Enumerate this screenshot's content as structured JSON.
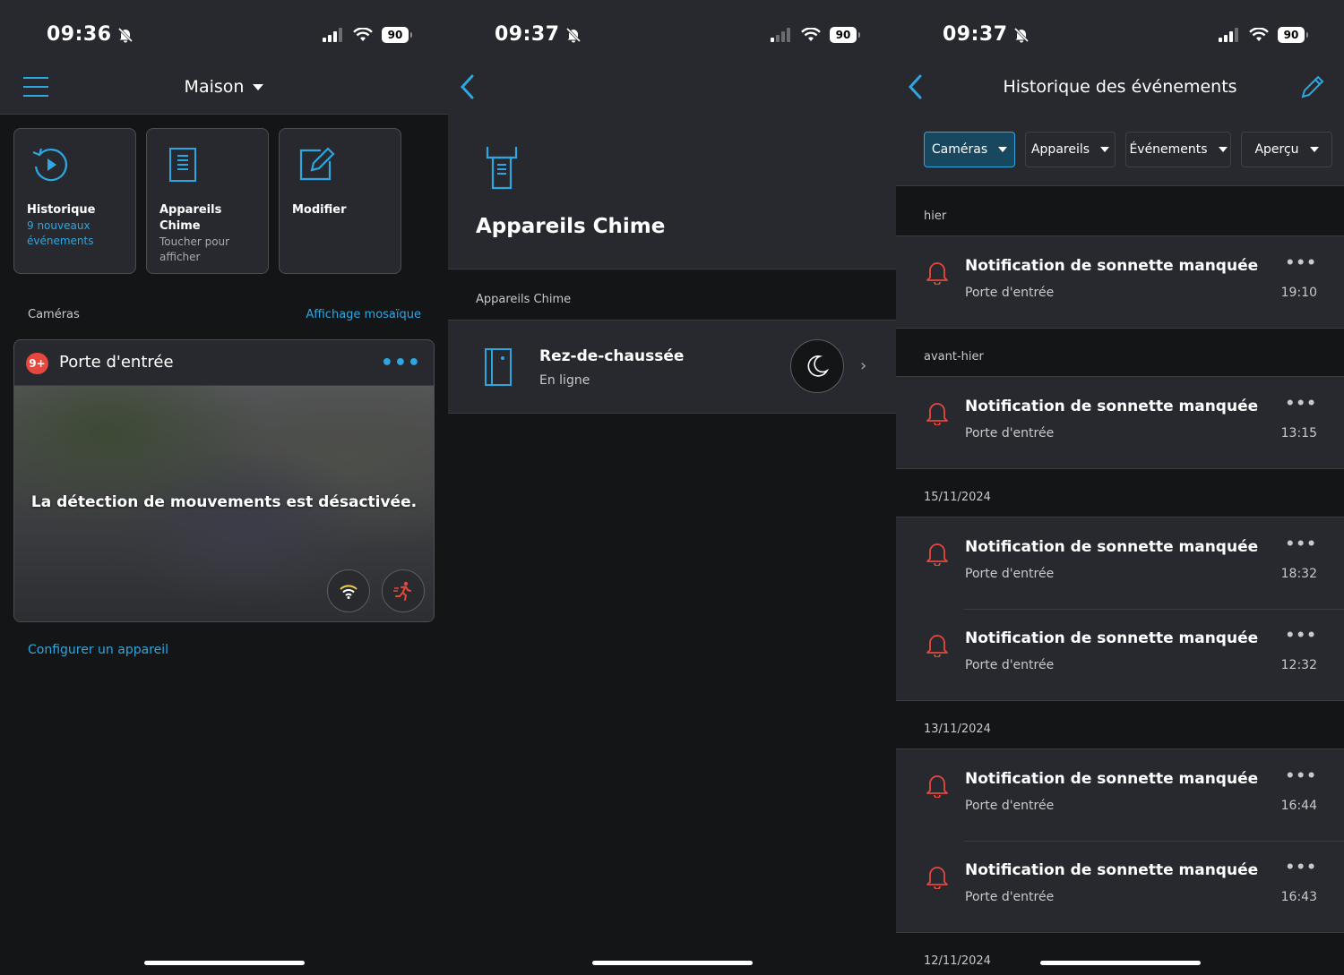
{
  "status": {
    "p1_time": "09:36",
    "p2_time": "09:37",
    "p3_time": "09:37",
    "battery": "90"
  },
  "home": {
    "title": "Maison",
    "tiles": [
      {
        "label": "Historique",
        "sub": "9 nouveaux événements"
      },
      {
        "label": "Appareils Chime",
        "sub": "Toucher pour afficher"
      },
      {
        "label": "Modifier",
        "sub": ""
      }
    ],
    "cameras_label": "Caméras",
    "mosaic_link": "Affichage mosaïque",
    "camera": {
      "badge": "9+",
      "name": "Porte d'entrée",
      "more": "•••",
      "message": "La détection de mouvements est désactivée."
    },
    "configure_link": "Configurer un appareil"
  },
  "chime": {
    "title": "Appareils Chime",
    "section": "Appareils Chime",
    "device": {
      "name": "Rez-de-chaussée",
      "status": "En ligne",
      "chevron": "›"
    }
  },
  "history": {
    "title": "Historique des événements",
    "filters": [
      "Caméras",
      "Appareils",
      "Événements",
      "Aperçu"
    ],
    "groups": [
      {
        "date": "hier",
        "events": [
          {
            "title": "Notification de sonnette manquée",
            "source": "Porte d'entrée",
            "time": "19:10"
          }
        ]
      },
      {
        "date": "avant-hier",
        "events": [
          {
            "title": "Notification de sonnette manquée",
            "source": "Porte d'entrée",
            "time": "13:15"
          }
        ]
      },
      {
        "date": "15/11/2024",
        "events": [
          {
            "title": "Notification de sonnette manquée",
            "source": "Porte d'entrée",
            "time": "18:32"
          },
          {
            "title": "Notification de sonnette manquée",
            "source": "Porte d'entrée",
            "time": "12:32"
          }
        ]
      },
      {
        "date": "13/11/2024",
        "events": [
          {
            "title": "Notification de sonnette manquée",
            "source": "Porte d'entrée",
            "time": "16:44"
          },
          {
            "title": "Notification de sonnette manquée",
            "source": "Porte d'entrée",
            "time": "16:43"
          }
        ]
      },
      {
        "date": "12/11/2024",
        "events": []
      }
    ],
    "more": "•••"
  },
  "colors": {
    "accent": "#2ea6e0",
    "bell": "#e5483d",
    "surface": "#27292e",
    "background": "#141517"
  }
}
